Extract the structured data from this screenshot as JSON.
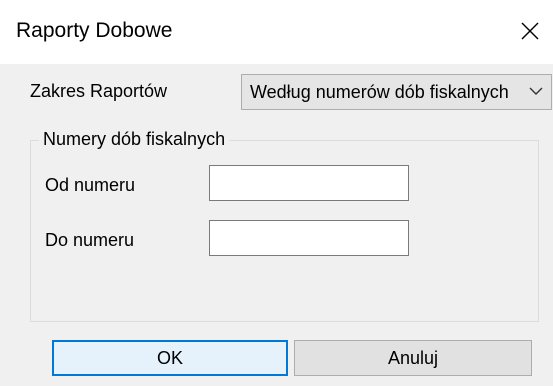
{
  "window": {
    "title": "Raporty Dobowe",
    "close_icon": "close-icon"
  },
  "range": {
    "label": "Zakres Raportów",
    "selected": "Według numerów dób fiskalnych",
    "arrow_icon": "chevron-down-icon"
  },
  "group": {
    "legend": "Numery dób fiskalnych",
    "from_label": "Od numeru",
    "from_value": "",
    "to_label": "Do numeru",
    "to_value": ""
  },
  "buttons": {
    "ok": "OK",
    "cancel": "Anuluj"
  },
  "colors": {
    "accent": "#0078d7",
    "dialog_bg": "#f0f0f0"
  }
}
